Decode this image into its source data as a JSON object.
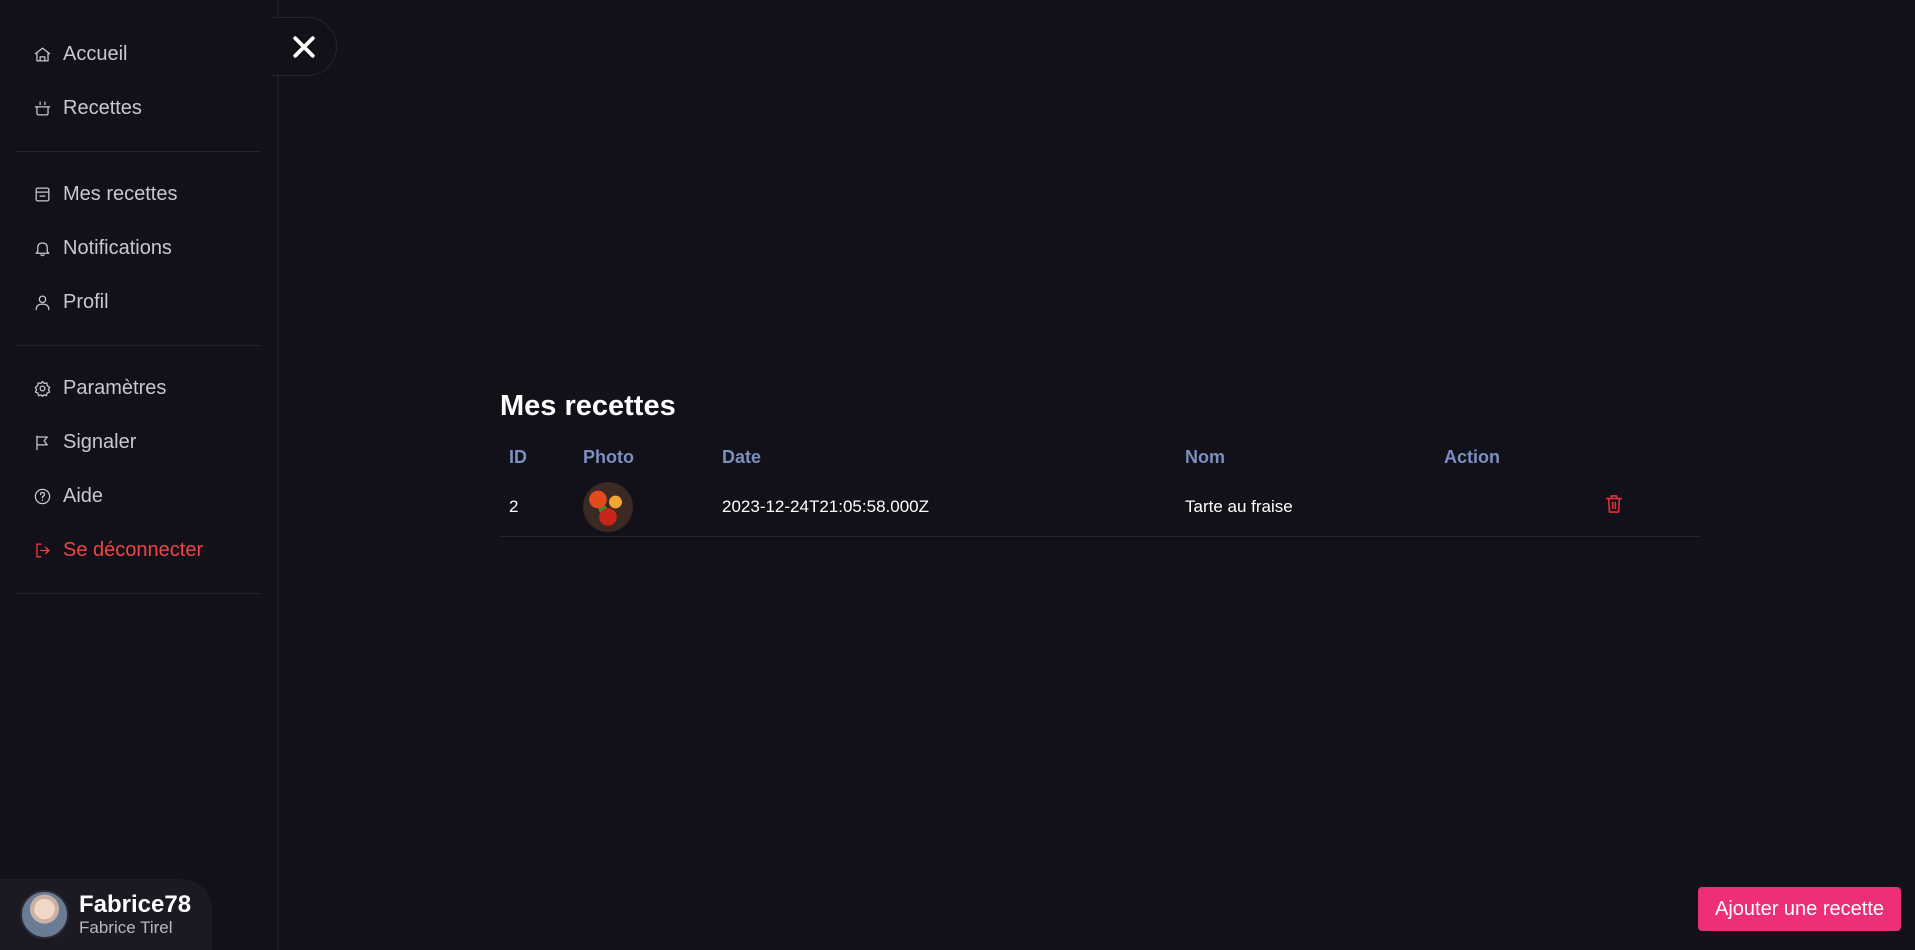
{
  "sidebar": {
    "group1": [
      {
        "label": "Accueil",
        "icon": "home-icon"
      },
      {
        "label": "Recettes",
        "icon": "pot-icon"
      }
    ],
    "group2": [
      {
        "label": "Mes recettes",
        "icon": "store-icon"
      },
      {
        "label": "Notifications",
        "icon": "bell-icon"
      },
      {
        "label": "Profil",
        "icon": "user-icon"
      }
    ],
    "group3": [
      {
        "label": "Paramètres",
        "icon": "gear-icon"
      },
      {
        "label": "Signaler",
        "icon": "flag-icon"
      },
      {
        "label": "Aide",
        "icon": "help-icon"
      },
      {
        "label": "Se déconnecter",
        "icon": "logout-icon"
      }
    ]
  },
  "user": {
    "handle": "Fabrice78",
    "fullname": "Fabrice Tirel"
  },
  "main": {
    "title": "Mes recettes",
    "table": {
      "headers": [
        "ID",
        "Photo",
        "Date",
        "Nom",
        "Action"
      ],
      "rows": [
        {
          "id": "2",
          "date": "2023-12-24T21:05:58.000Z",
          "name": "Tarte au fraise"
        }
      ]
    }
  },
  "actions": {
    "add_label": "Ajouter une recette"
  },
  "colors": {
    "accent": "#ee2f77",
    "danger": "#f14444",
    "header": "#7b8fc0",
    "background": "#121018"
  }
}
